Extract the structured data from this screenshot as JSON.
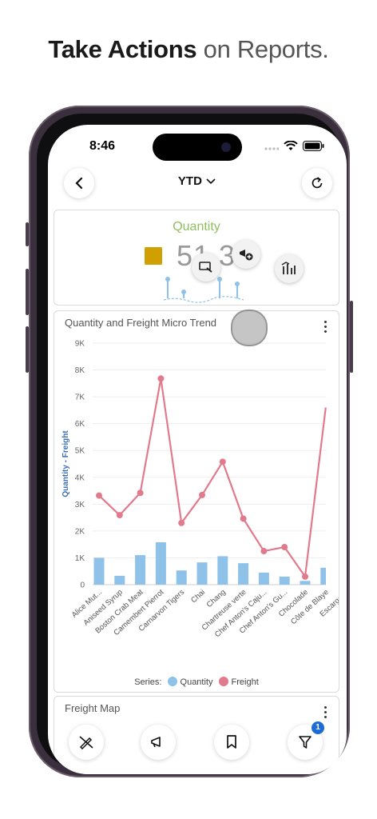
{
  "headline": {
    "bold": "Take Actions",
    "light": "on Reports."
  },
  "status": {
    "time": "8:46"
  },
  "nav": {
    "title": "YTD"
  },
  "kpi": {
    "label": "Quantity",
    "value": "51,3",
    "swatch_color": "#cfa000",
    "label_color": "#8fbf5f"
  },
  "chart": {
    "title": "Quantity and Freight Micro Trend",
    "ylabel": "Quantity  -  Freight",
    "legend_prefix": "Series:",
    "colors": {
      "quantity": "#8fc2e8",
      "freight": "#e07a8c"
    }
  },
  "chart_data": {
    "type": "bar",
    "title": "Quantity and Freight Micro Trend",
    "ylabel": "Quantity  -  Freight",
    "ylim": [
      0,
      9000
    ],
    "yticks": [
      "0",
      "1K",
      "2K",
      "3K",
      "4K",
      "5K",
      "6K",
      "7K",
      "8K",
      "9K"
    ],
    "categories": [
      "Alice Mut...",
      "Aniseed Syrup",
      "Boston Crab Meat",
      "Camembert Pierrot",
      "Carnarvon Tigers",
      "Chai",
      "Chang",
      "Chartreuse verte",
      "Chef Anton's Caju...",
      "Chef Anton's Gu...",
      "Chocolade",
      "Côte de Blaye",
      "Escargot..."
    ],
    "series": [
      {
        "name": "Quantity",
        "type": "bar",
        "values": [
          1000,
          330,
          1100,
          1580,
          530,
          830,
          1060,
          800,
          450,
          300,
          140,
          630,
          0
        ]
      },
      {
        "name": "Freight",
        "type": "line",
        "values": [
          3320,
          2590,
          3420,
          7680,
          2300,
          3340,
          4580,
          2460,
          1250,
          1400,
          300,
          6600,
          null
        ]
      }
    ],
    "grid": true,
    "legend_position": "bottom"
  },
  "card3": {
    "title": "Freight Map"
  }
}
